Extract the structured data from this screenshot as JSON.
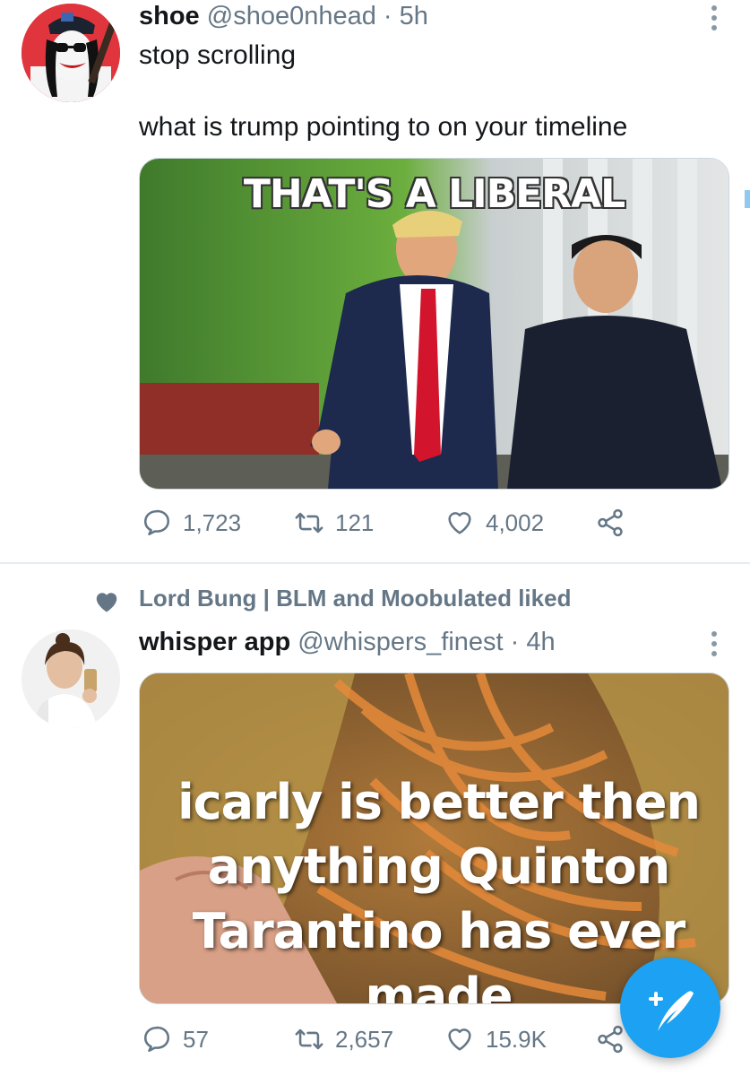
{
  "colors": {
    "accent": "#1da1f2",
    "secondary_text": "#657786",
    "divider": "#e6ecf0"
  },
  "tweets": [
    {
      "author_name": "shoe",
      "handle_time": "@shoe0nhead · 5h",
      "text": "stop scrolling\n\nwhat is trump pointing to on your timeline",
      "media_caption": "THAT'S A LIBERAL",
      "reply_count": "1,723",
      "retweet_count": "121",
      "like_count": "4,002"
    },
    {
      "social_context": "Lord Bung | BLM and Moobulated liked",
      "author_name": "whisper app",
      "handle_time": "@whispers_finest · 4h",
      "media_caption": "icarly is better then anything Quinton Tarantino has ever made",
      "reply_count": "57",
      "retweet_count": "2,657",
      "like_count": "15.9K"
    }
  ],
  "icons": {
    "reply": "reply-icon",
    "retweet": "retweet-icon",
    "like": "heart-icon",
    "share": "share-icon",
    "compose": "compose-tweet-icon",
    "more": "more-options-icon"
  }
}
